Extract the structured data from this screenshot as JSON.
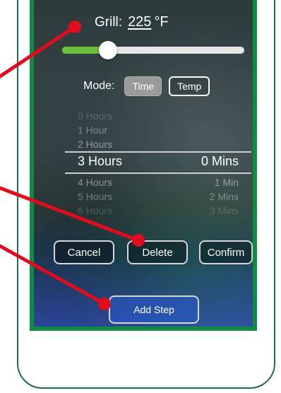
{
  "grill": {
    "label": "Grill:",
    "temp_value": "225",
    "unit": "°F"
  },
  "temperature_slider": {
    "level_fraction": 0.25,
    "colors": {
      "fill": "#6bbf3b",
      "track": "#e6e6e6",
      "knob": "#ffffff"
    }
  },
  "mode": {
    "label": "Mode:",
    "options": [
      {
        "label": "Time",
        "selected": true
      },
      {
        "label": "Temp",
        "selected": false
      }
    ]
  },
  "duration_picker": {
    "hours": {
      "above_faint": "0 Hours",
      "above_2": "1 Hour",
      "above_1": "2 Hours",
      "selected": "3 Hours",
      "below_1": "4 Hours",
      "below_2": "5 Hours",
      "below_faint": "6 Hours"
    },
    "minutes": {
      "selected": "0 Mins",
      "below_1": "1 Min",
      "below_2": "2 Mins",
      "below_faint": "3 Mins"
    }
  },
  "actions": {
    "cancel": "Cancel",
    "delete": "Delete",
    "confirm": "Confirm"
  },
  "add_step": "Add Step",
  "annotation_colors": {
    "pointer": "#e00b1c",
    "frame_border": "#1f6b4a",
    "screen_border": "#0f8b44"
  }
}
